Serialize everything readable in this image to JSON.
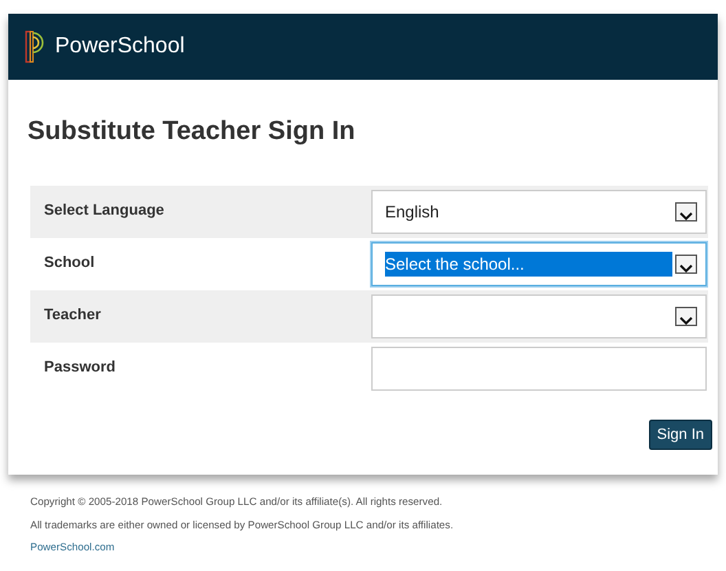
{
  "header": {
    "brand": "PowerSchool"
  },
  "title": "Substitute Teacher Sign In",
  "fields": [
    {
      "label": "Select Language",
      "kind": "select",
      "value": "English",
      "shaded": true,
      "focused": false
    },
    {
      "label": "School",
      "kind": "select",
      "value": "Select the school...",
      "shaded": false,
      "focused": true
    },
    {
      "label": "Teacher",
      "kind": "select",
      "shaded": true,
      "focused": false
    },
    {
      "label": "Password",
      "kind": "password",
      "shaded": false,
      "focused": false
    }
  ],
  "submit": "Sign In",
  "footer": {
    "lines": [
      "Copyright © 2005-2018 PowerSchool Group LLC and/or its affiliate(s). All rights reserved.",
      "All trademarks are either owned or licensed by PowerSchool Group LLC and/or its affiliates."
    ],
    "link": "PowerSchool.com"
  }
}
